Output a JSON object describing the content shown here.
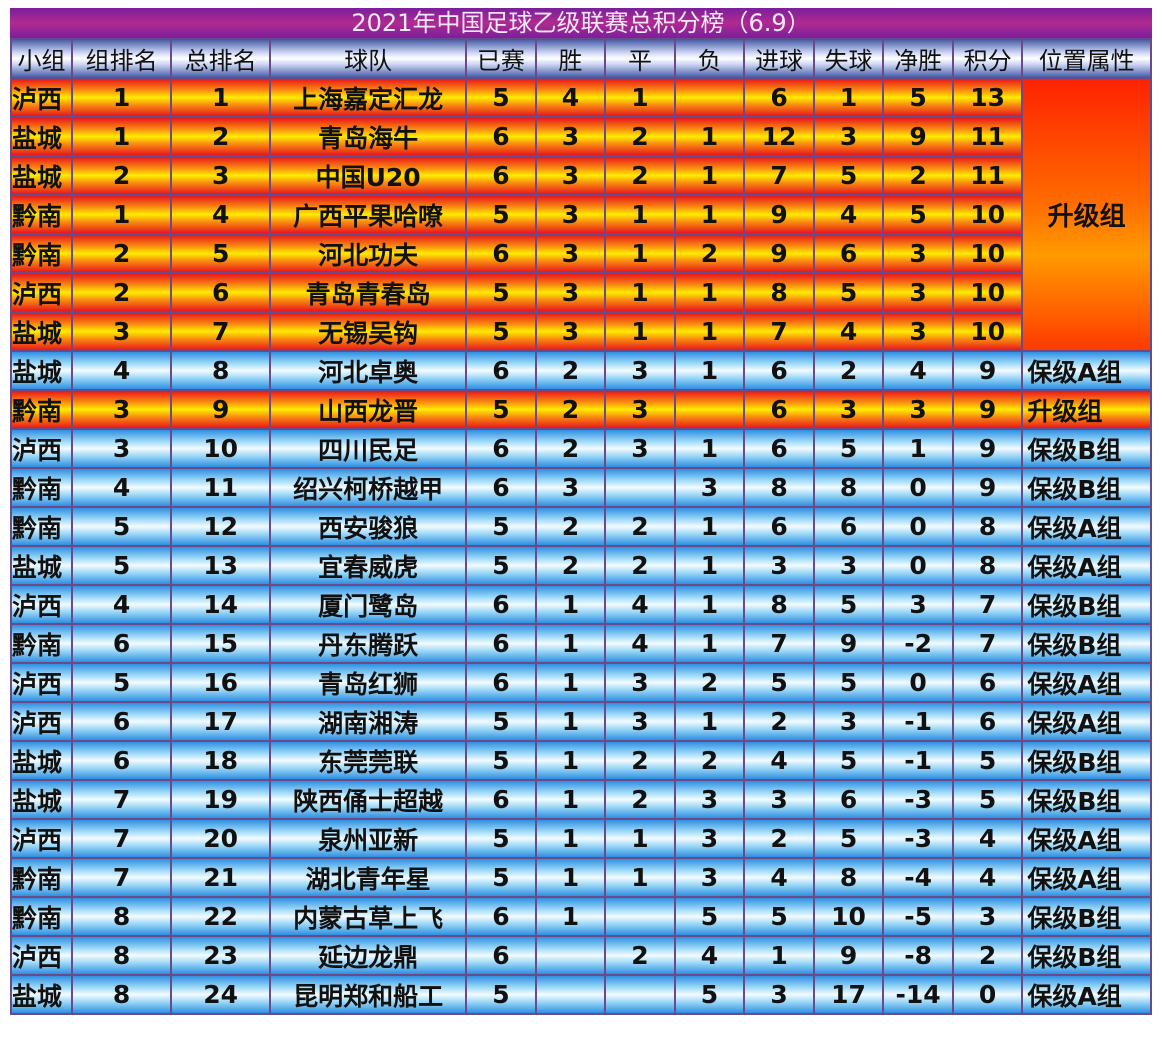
{
  "title": "2021年中国足球乙级联赛总积分榜（6.9）",
  "headers": [
    "小组",
    "组排名",
    "总排名",
    "球队",
    "已赛",
    "胜",
    "平",
    "负",
    "进球",
    "失球",
    "净胜",
    "积分",
    "位置属性"
  ],
  "colors": {
    "promotion": "#f98c10",
    "relegation": "#9bd8f7",
    "header": "#cfd8f5",
    "title_bar": "#b02a8f"
  },
  "rows": [
    {
      "group": "泸西",
      "grp_rank": "1",
      "total_rank": "1",
      "team": "上海嘉定汇龙",
      "played": "5",
      "win": "4",
      "draw": "1",
      "loss": "",
      "gf": "6",
      "ga": "1",
      "gd": "5",
      "pts": "13",
      "attr": "升级组",
      "zone": "up"
    },
    {
      "group": "盐城",
      "grp_rank": "1",
      "total_rank": "2",
      "team": "青岛海牛",
      "played": "6",
      "win": "3",
      "draw": "2",
      "loss": "1",
      "gf": "12",
      "ga": "3",
      "gd": "9",
      "pts": "11",
      "attr": "",
      "zone": "up"
    },
    {
      "group": "盐城",
      "grp_rank": "2",
      "total_rank": "3",
      "team": "中国U20",
      "played": "6",
      "win": "3",
      "draw": "2",
      "loss": "1",
      "gf": "7",
      "ga": "5",
      "gd": "2",
      "pts": "11",
      "attr": "",
      "zone": "up"
    },
    {
      "group": "黔南",
      "grp_rank": "1",
      "total_rank": "4",
      "team": "广西平果哈嘹",
      "played": "5",
      "win": "3",
      "draw": "1",
      "loss": "1",
      "gf": "9",
      "ga": "4",
      "gd": "5",
      "pts": "10",
      "attr": "",
      "zone": "up"
    },
    {
      "group": "黔南",
      "grp_rank": "2",
      "total_rank": "5",
      "team": "河北功夫",
      "played": "6",
      "win": "3",
      "draw": "1",
      "loss": "2",
      "gf": "9",
      "ga": "6",
      "gd": "3",
      "pts": "10",
      "attr": "",
      "zone": "up"
    },
    {
      "group": "泸西",
      "grp_rank": "2",
      "total_rank": "6",
      "team": "青岛青春岛",
      "played": "5",
      "win": "3",
      "draw": "1",
      "loss": "1",
      "gf": "8",
      "ga": "5",
      "gd": "3",
      "pts": "10",
      "attr": "",
      "zone": "up"
    },
    {
      "group": "盐城",
      "grp_rank": "3",
      "total_rank": "7",
      "team": "无锡吴钩",
      "played": "5",
      "win": "3",
      "draw": "1",
      "loss": "1",
      "gf": "7",
      "ga": "4",
      "gd": "3",
      "pts": "10",
      "attr": "",
      "zone": "up"
    },
    {
      "group": "盐城",
      "grp_rank": "4",
      "total_rank": "8",
      "team": "河北卓奥",
      "played": "6",
      "win": "2",
      "draw": "3",
      "loss": "1",
      "gf": "6",
      "ga": "2",
      "gd": "4",
      "pts": "9",
      "attr": "保级A组",
      "zone": "keep"
    },
    {
      "group": "黔南",
      "grp_rank": "3",
      "total_rank": "9",
      "team": "山西龙晋",
      "played": "5",
      "win": "2",
      "draw": "3",
      "loss": "",
      "gf": "6",
      "ga": "3",
      "gd": "3",
      "pts": "9",
      "attr": "升级组",
      "zone": "up"
    },
    {
      "group": "泸西",
      "grp_rank": "3",
      "total_rank": "10",
      "team": "四川民足",
      "played": "6",
      "win": "2",
      "draw": "3",
      "loss": "1",
      "gf": "6",
      "ga": "5",
      "gd": "1",
      "pts": "9",
      "attr": "保级B组",
      "zone": "keep"
    },
    {
      "group": "黔南",
      "grp_rank": "4",
      "total_rank": "11",
      "team": "绍兴柯桥越甲",
      "played": "6",
      "win": "3",
      "draw": "",
      "loss": "3",
      "gf": "8",
      "ga": "8",
      "gd": "0",
      "pts": "9",
      "attr": "保级B组",
      "zone": "keep"
    },
    {
      "group": "黔南",
      "grp_rank": "5",
      "total_rank": "12",
      "team": "西安骏狼",
      "played": "5",
      "win": "2",
      "draw": "2",
      "loss": "1",
      "gf": "6",
      "ga": "6",
      "gd": "0",
      "pts": "8",
      "attr": "保级A组",
      "zone": "keep"
    },
    {
      "group": "盐城",
      "grp_rank": "5",
      "total_rank": "13",
      "team": "宜春威虎",
      "played": "5",
      "win": "2",
      "draw": "2",
      "loss": "1",
      "gf": "3",
      "ga": "3",
      "gd": "0",
      "pts": "8",
      "attr": "保级A组",
      "zone": "keep"
    },
    {
      "group": "泸西",
      "grp_rank": "4",
      "total_rank": "14",
      "team": "厦门鹭岛",
      "played": "6",
      "win": "1",
      "draw": "4",
      "loss": "1",
      "gf": "8",
      "ga": "5",
      "gd": "3",
      "pts": "7",
      "attr": "保级B组",
      "zone": "keep"
    },
    {
      "group": "黔南",
      "grp_rank": "6",
      "total_rank": "15",
      "team": "丹东腾跃",
      "played": "6",
      "win": "1",
      "draw": "4",
      "loss": "1",
      "gf": "7",
      "ga": "9",
      "gd": "-2",
      "pts": "7",
      "attr": "保级B组",
      "zone": "keep"
    },
    {
      "group": "泸西",
      "grp_rank": "5",
      "total_rank": "16",
      "team": "青岛红狮",
      "played": "6",
      "win": "1",
      "draw": "3",
      "loss": "2",
      "gf": "5",
      "ga": "5",
      "gd": "0",
      "pts": "6",
      "attr": "保级A组",
      "zone": "keep"
    },
    {
      "group": "泸西",
      "grp_rank": "6",
      "total_rank": "17",
      "team": "湖南湘涛",
      "played": "5",
      "win": "1",
      "draw": "3",
      "loss": "1",
      "gf": "2",
      "ga": "3",
      "gd": "-1",
      "pts": "6",
      "attr": "保级A组",
      "zone": "keep"
    },
    {
      "group": "盐城",
      "grp_rank": "6",
      "total_rank": "18",
      "team": "东莞莞联",
      "played": "5",
      "win": "1",
      "draw": "2",
      "loss": "2",
      "gf": "4",
      "ga": "5",
      "gd": "-1",
      "pts": "5",
      "attr": "保级B组",
      "zone": "keep"
    },
    {
      "group": "盐城",
      "grp_rank": "7",
      "total_rank": "19",
      "team": "陕西俑士超越",
      "played": "6",
      "win": "1",
      "draw": "2",
      "loss": "3",
      "gf": "3",
      "ga": "6",
      "gd": "-3",
      "pts": "5",
      "attr": "保级B组",
      "zone": "keep"
    },
    {
      "group": "泸西",
      "grp_rank": "7",
      "total_rank": "20",
      "team": "泉州亚新",
      "played": "5",
      "win": "1",
      "draw": "1",
      "loss": "3",
      "gf": "2",
      "ga": "5",
      "gd": "-3",
      "pts": "4",
      "attr": "保级A组",
      "zone": "keep"
    },
    {
      "group": "黔南",
      "grp_rank": "7",
      "total_rank": "21",
      "team": "湖北青年星",
      "played": "5",
      "win": "1",
      "draw": "1",
      "loss": "3",
      "gf": "4",
      "ga": "8",
      "gd": "-4",
      "pts": "4",
      "attr": "保级A组",
      "zone": "keep"
    },
    {
      "group": "黔南",
      "grp_rank": "8",
      "total_rank": "22",
      "team": "内蒙古草上飞",
      "played": "6",
      "win": "1",
      "draw": "",
      "loss": "5",
      "gf": "5",
      "ga": "10",
      "gd": "-5",
      "pts": "3",
      "attr": "保级B组",
      "zone": "keep"
    },
    {
      "group": "泸西",
      "grp_rank": "8",
      "total_rank": "23",
      "team": "延边龙鼎",
      "played": "6",
      "win": "",
      "draw": "2",
      "loss": "4",
      "gf": "1",
      "ga": "9",
      "gd": "-8",
      "pts": "2",
      "attr": "保级B组",
      "zone": "keep"
    },
    {
      "group": "盐城",
      "grp_rank": "8",
      "total_rank": "24",
      "team": "昆明郑和船工",
      "played": "5",
      "win": "",
      "draw": "",
      "loss": "5",
      "gf": "3",
      "ga": "17",
      "gd": "-14",
      "pts": "0",
      "attr": "保级A组",
      "zone": "keep"
    }
  ]
}
